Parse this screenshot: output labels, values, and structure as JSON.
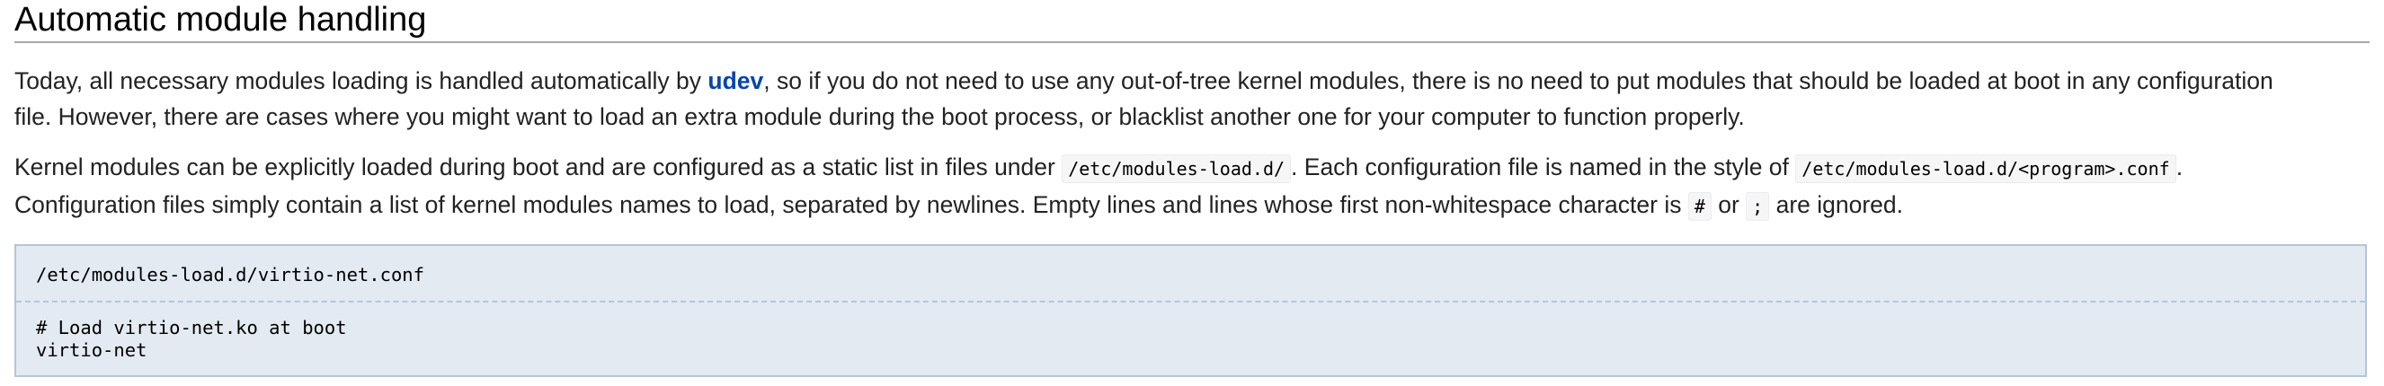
{
  "section": {
    "heading": "Automatic module handling"
  },
  "paragraph1": {
    "before_link": "Today, all necessary modules loading is handled automatically by ",
    "link_text": "udev",
    "after_link": ", so if you do not need to use any out-of-tree kernel modules, there is no need to put modules that should be loaded at boot in any configuration",
    "line2": "file. However, there are cases where you might want to load an extra module during the boot process, or blacklist another one for your computer to function properly."
  },
  "paragraph2": {
    "text1": "Kernel modules can be explicitly loaded during boot and are configured as a static list in files under ",
    "code1": "/etc/modules-load.d/",
    "text2": ". Each configuration file is named in the style of ",
    "code2": "/etc/modules-load.d/<program>.conf",
    "text3": ".",
    "line2_text1": "Configuration files simply contain a list of kernel modules names to load, separated by newlines. Empty lines and lines whose first non-whitespace character is ",
    "code3": "#",
    "line2_text2": " or ",
    "code4": ";",
    "line2_text3": " are ignored."
  },
  "code_block": {
    "filename": "/etc/modules-load.d/virtio-net.conf",
    "lines": [
      "# Load virtio-net.ko at boot",
      "virtio-net"
    ]
  }
}
